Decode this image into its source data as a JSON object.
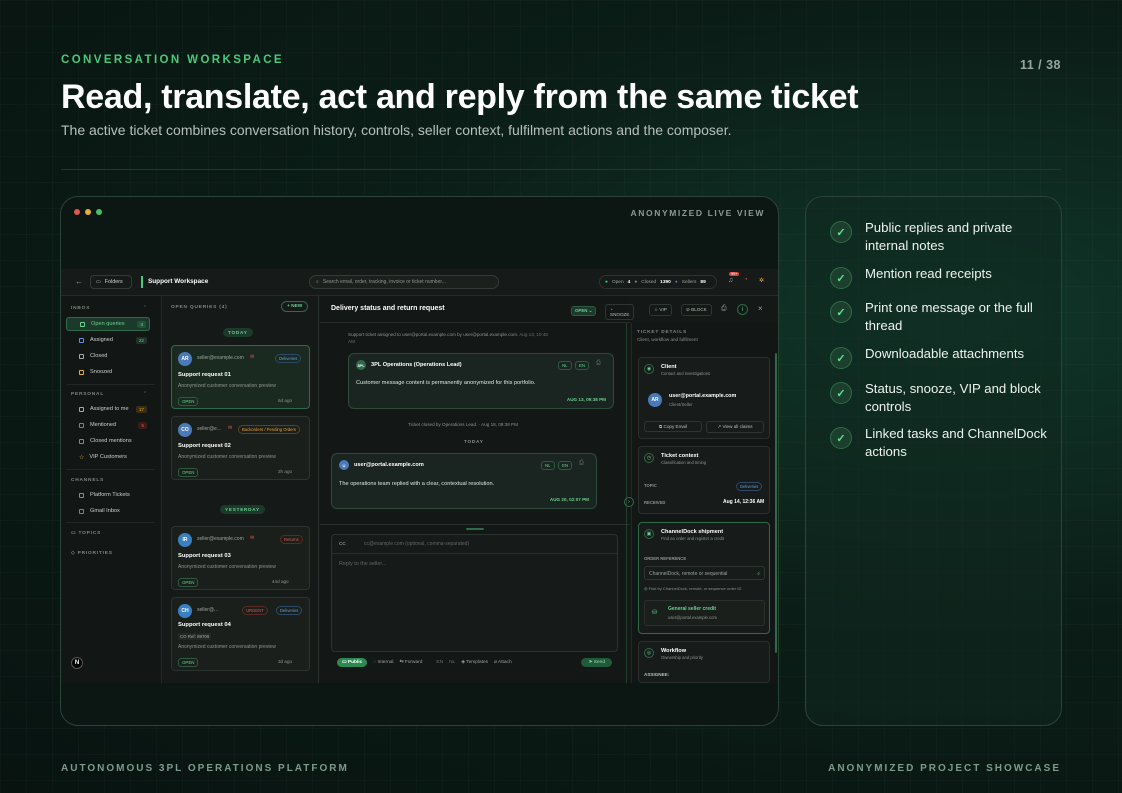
{
  "slide": {
    "eyebrow": "CONVERSATION WORKSPACE",
    "page": "11 / 38",
    "title": "Read, translate, act and reply from the same ticket",
    "subtitle": "The active ticket combines conversation history, controls, seller context, fulfilment actions and the composer.",
    "footer_left": "AUTONOMOUS 3PL OPERATIONS PLATFORM",
    "footer_right": "ANONYMIZED PROJECT SHOWCASE"
  },
  "frame": {
    "label": "ANONYMIZED LIVE VIEW"
  },
  "topbar": {
    "folders": "Folders",
    "workspace": "Support Workspace",
    "search_placeholder": "Search email, order, tracking, invoice or ticket number...",
    "open_label": "Open",
    "open_count": "4",
    "closed_label": "Closed",
    "closed_count": "1390",
    "sellers_label": "Sellers",
    "sellers_count": "89",
    "notif": "99+"
  },
  "sidebar": {
    "inbox": "INBOX",
    "open_queries": "Open queries",
    "open_queries_count": "4",
    "assigned": "Assigned",
    "assigned_count": "22",
    "closed": "Closed",
    "snoozed": "Snoozed",
    "personal": "PERSONAL",
    "assigned_to_me": "Assigned to me",
    "assigned_to_me_count": "17",
    "mentioned": "Mentioned",
    "mentioned_count": "5",
    "closed_mentions": "Closed mentions",
    "vip": "VIP Customers",
    "channels": "CHANNELS",
    "platform": "Platform Tickets",
    "gmail": "Gmail Inbox",
    "topics": "TOPICS",
    "priorities": "PRIORITIES"
  },
  "queue": {
    "header": "OPEN QUERIES (4)",
    "new": "+ NEW",
    "today": "TODAY",
    "yesterday": "YESTERDAY",
    "tickets": [
      {
        "initials": "AR",
        "email": "seller@example.com",
        "tag": "Deliveries",
        "subject": "Support request 01",
        "preview": "Anonymized customer conversation preview",
        "status": "OPEN",
        "age": "6d ago"
      },
      {
        "initials": "CO",
        "email": "seller@e...",
        "tag": "Backorders / Pending Orders",
        "subject": "Support request 02",
        "preview": "Anonymized customer conversation preview",
        "status": "OPEN",
        "age": "2h ago"
      },
      {
        "initials": "IR",
        "email": "seller@example.com",
        "tag": "Returns",
        "subject": "Support request 03",
        "preview": "Anonymized customer conversation preview",
        "status": "OPEN",
        "age": "44d ago"
      },
      {
        "initials": "CH",
        "email": "seller@...",
        "tag": "URGENT",
        "tag2": "Deliveries",
        "subject": "Support request 04",
        "extra": "CO Ref: 89706",
        "preview": "Anonymized customer conversation preview",
        "status": "OPEN",
        "age": "3d ago"
      }
    ]
  },
  "chat": {
    "title": "Delivery status and return request",
    "status": "OPEN",
    "snooze": "SNOOZE",
    "vip": "VIP",
    "block": "BLOCK",
    "sys1": "Support ticket assigned to user@portal.example.com by user@portal.example.com.",
    "sys1_time": "Aug 13, 10:48 AM",
    "msg1_author": "3PL Operations (Operations Lead)",
    "msg1_text": "Customer message content is permanently anonymized for this portfolio.",
    "msg1_time": "AUG 13, 09:38 PM",
    "sys2": "Ticket closed by Operations Lead.",
    "sys2_time": "Aug 18, 09:38 PM",
    "today": "TODAY",
    "msg2_author": "user@portal.example.com",
    "msg2_text": "The operations team replied with a clear, contextual resolution.",
    "msg2_time": "AUG 20, 02:07 PM",
    "lang1": "NL",
    "lang2": "EN",
    "cc_label": "CC",
    "cc_placeholder": "cc@example.com (optional, comma-separated)",
    "reply_placeholder": "Reply to the seller...",
    "tab_public": "Public",
    "tab_internal": "Internal",
    "tab_forward": "Forward",
    "templates": "Templates",
    "attach": "Attach",
    "send": "Send"
  },
  "details": {
    "header": "TICKET DETAILS",
    "sub": "Client, workflow and fulfilment",
    "client_title": "Client",
    "client_sub": "Contact and investigations",
    "client_email": "user@portal.example.com",
    "client_role": "Client/Seller",
    "copy_email": "Copy Email",
    "view_claims": "View all claims",
    "ctx_title": "Ticket context",
    "ctx_sub": "Classification and timing",
    "topic_label": "TOPIC",
    "topic": "Deliveries",
    "received_label": "RECEIVED",
    "received": "Aug 14, 12:36 AM",
    "cd_title": "ChannelDock shipment",
    "cd_sub": "Find an order and register a credit",
    "order_ref": "ORDER REFERENCE",
    "order_placeholder": "ChannelDock, remote or sequential",
    "order_hint": "Find by ChannelDock, remote, or sequence order ID",
    "credit_title": "General seller credit",
    "credit_email": "user@portal.example.com",
    "wf_title": "Workflow",
    "wf_sub": "Ownership and priority",
    "assignee": "ASSIGNEE:"
  },
  "features": [
    "Public replies and private internal notes",
    "Mention read receipts",
    "Print one message or the full thread",
    "Downloadable attachments",
    "Status, snooze, VIP and block controls",
    "Linked tasks and ChannelDock actions"
  ],
  "colors": {
    "accent": "#49c97c",
    "background": "#0a1612"
  }
}
